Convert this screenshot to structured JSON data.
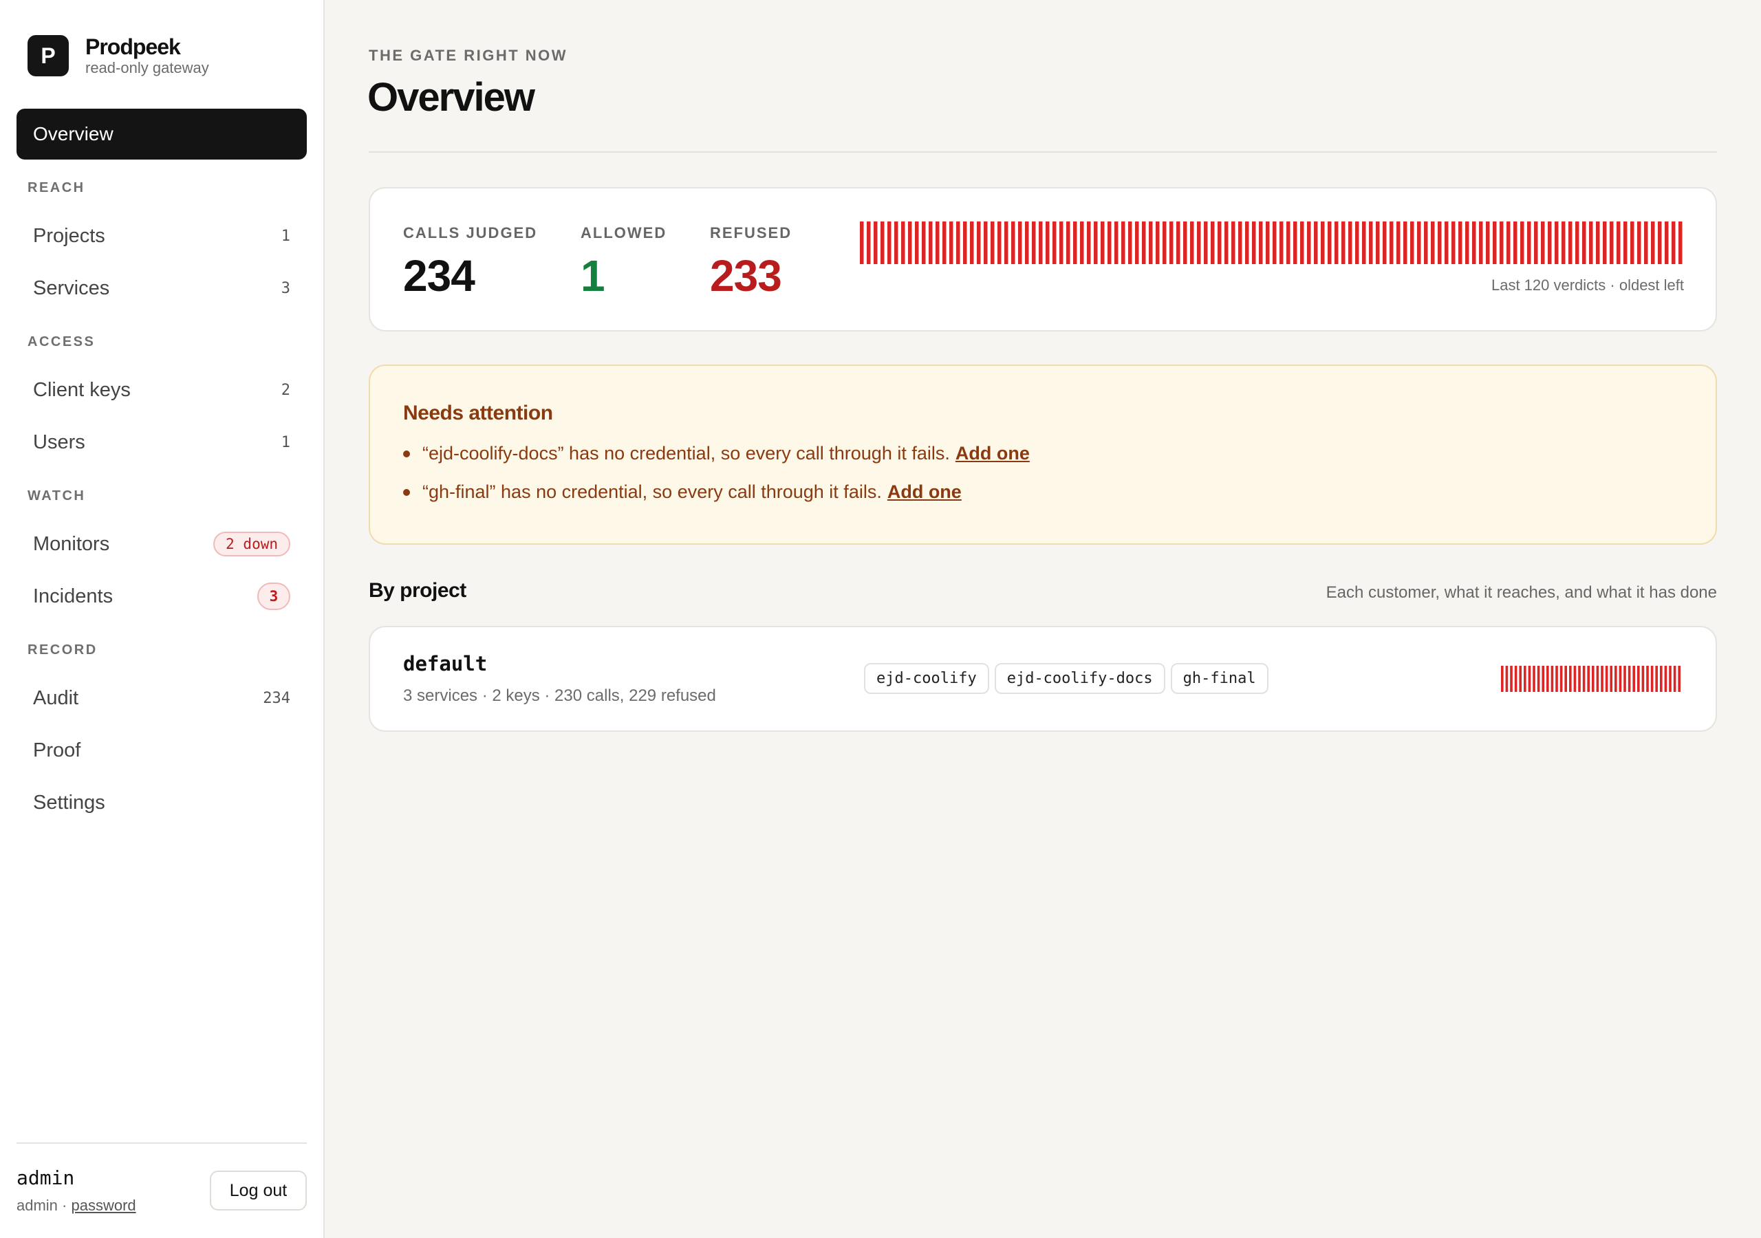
{
  "brand": {
    "logo_letter": "P",
    "name": "Prodpeek",
    "subtitle": "read-only gateway"
  },
  "nav": {
    "active": "Overview",
    "sections": [
      {
        "title": "REACH",
        "items": [
          {
            "label": "Projects",
            "count": "1"
          },
          {
            "label": "Services",
            "count": "3"
          }
        ]
      },
      {
        "title": "ACCESS",
        "items": [
          {
            "label": "Client keys",
            "count": "2"
          },
          {
            "label": "Users",
            "count": "1"
          }
        ]
      },
      {
        "title": "WATCH",
        "items": [
          {
            "label": "Monitors",
            "badge": "2 down"
          },
          {
            "label": "Incidents",
            "badge": "3"
          }
        ]
      },
      {
        "title": "RECORD",
        "items": [
          {
            "label": "Audit",
            "count": "234"
          },
          {
            "label": "Proof"
          },
          {
            "label": "Settings"
          }
        ]
      }
    ]
  },
  "user": {
    "name": "admin",
    "role": "admin",
    "separator": "·",
    "auth_link": "password",
    "logout_label": "Log out"
  },
  "header": {
    "eyebrow": "THE GATE RIGHT NOW",
    "title": "Overview"
  },
  "stats": {
    "calls_label": "CALLS JUDGED",
    "calls_value": "234",
    "allowed_label": "ALLOWED",
    "allowed_value": "1",
    "refused_label": "REFUSED",
    "refused_value": "233",
    "verdicts_caption": "Last 120 verdicts · oldest left",
    "verdict_count": 120,
    "verdict_color": "#dc2626"
  },
  "attention": {
    "title": "Needs attention",
    "items": [
      {
        "text": "“ejd-coolify-docs” has no credential, so every call through it fails.",
        "link": "Add one"
      },
      {
        "text": "“gh-final” has no credential, so every call through it fails.",
        "link": "Add one"
      }
    ]
  },
  "projects_section": {
    "title": "By project",
    "subtitle": "Each customer, what it reaches, and what it has done"
  },
  "projects": [
    {
      "name": "default",
      "meta": "3 services · 2 keys · 230 calls, 229 refused",
      "services": [
        "ejd-coolify",
        "ejd-coolify-docs",
        "gh-final"
      ],
      "verdict_count": 40
    }
  ]
}
